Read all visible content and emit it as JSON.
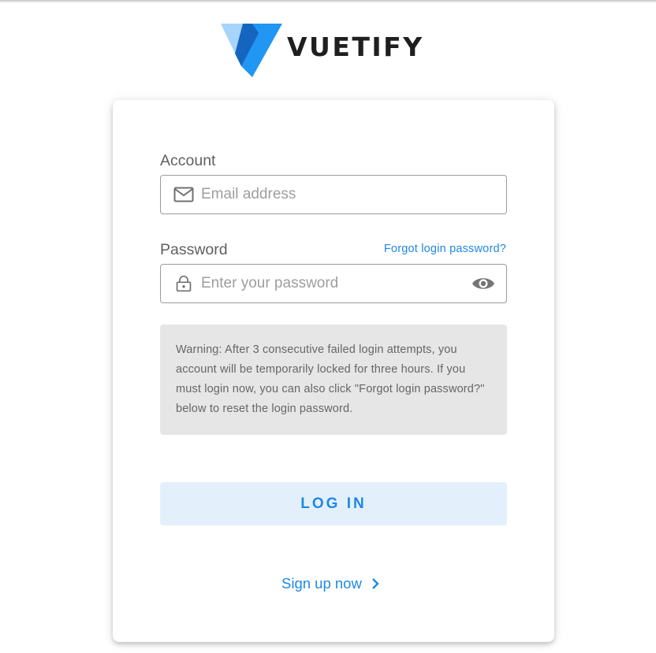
{
  "brand": {
    "name": "VUETIFY",
    "colors": {
      "light_blue": "#a6d4fa",
      "mid_blue": "#2196f3",
      "dark_blue": "#1565c0",
      "wordmark": "#1f1f1f"
    }
  },
  "form": {
    "account": {
      "label": "Account",
      "placeholder": "Email address",
      "icon": "mail-icon"
    },
    "password": {
      "label": "Password",
      "placeholder": "Enter your password",
      "forgot_link": "Forgot login password?",
      "icon": "lock-icon",
      "toggle_icon": "eye-icon"
    },
    "warning": "Warning: After 3 consecutive failed login attempts, you account will be temporarily locked for three hours. If you must login now, you can also click \"Forgot login password?\" below to reset the login password.",
    "login_label": "LOG IN",
    "signup_label": "Sign up now",
    "signup_icon": "chevron-right-icon"
  },
  "colors": {
    "accent": "#1e88e5",
    "button_bg": "#e3f0fc",
    "warning_bg": "#e6e6e6",
    "border": "#9b9b9b"
  }
}
